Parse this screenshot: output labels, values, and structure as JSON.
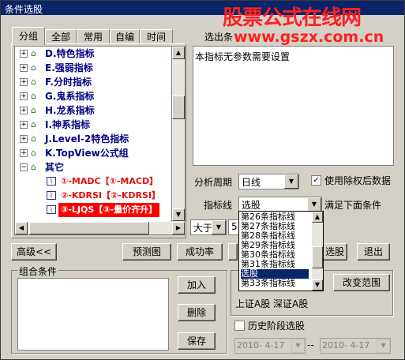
{
  "window": {
    "title": "条件选股"
  },
  "brand": {
    "line1": "股票公式在线网",
    "line2": "www.gszx.com.cn"
  },
  "tabs": [
    {
      "label": "分组"
    },
    {
      "label": "全部"
    },
    {
      "label": "常用"
    },
    {
      "label": "自编"
    },
    {
      "label": "时间"
    }
  ],
  "tree": {
    "groups": [
      {
        "label": "D.特色指标"
      },
      {
        "label": "E.强弱指标"
      },
      {
        "label": "F.分时指标"
      },
      {
        "label": "G.鬼系指标"
      },
      {
        "label": "H.龙系指标"
      },
      {
        "label": "I.神系指标"
      },
      {
        "label": "J.Level-2特色指标"
      },
      {
        "label": "K.TopView公式组"
      },
      {
        "label": "其它"
      }
    ],
    "children": [
      {
        "label": "①-MADC【①-MACD】"
      },
      {
        "label": "②-KDRSI【②-KDRSI】"
      },
      {
        "label": "③-LJQS【③-量价齐升】"
      }
    ]
  },
  "right": {
    "desc_header": "选出条",
    "desc_text": "本指标无参数需要设置",
    "period_label": "分析周期",
    "period_value": "日线",
    "rights_label": "使用除权后数据",
    "indicator_label": "指标线",
    "indicator_value": "选股",
    "satisfy_label": "满足下面条件",
    "compare_value": "大于",
    "compare_num": "5"
  },
  "dropdown": {
    "items": [
      "第26条指标线",
      "第27条指标线",
      "第28条指标线",
      "第29条指标线",
      "第30条指标线",
      "第31条指标线",
      "选股",
      "第33条指标线"
    ],
    "selected": "选股"
  },
  "buttons": {
    "advanced": "高级<<",
    "preview": "预测图",
    "success": "成功率",
    "select": "选股",
    "exit": "退出",
    "add": "加入",
    "delete": "删除",
    "save": "保存",
    "range": "改变范围"
  },
  "combo": {
    "title": "组合条件"
  },
  "range": {
    "text": "上证A股 深证A股"
  },
  "history": {
    "label": "历史阶段选股",
    "from": "2010- 4-17",
    "sep": "--",
    "to": "2010- 4-17"
  }
}
